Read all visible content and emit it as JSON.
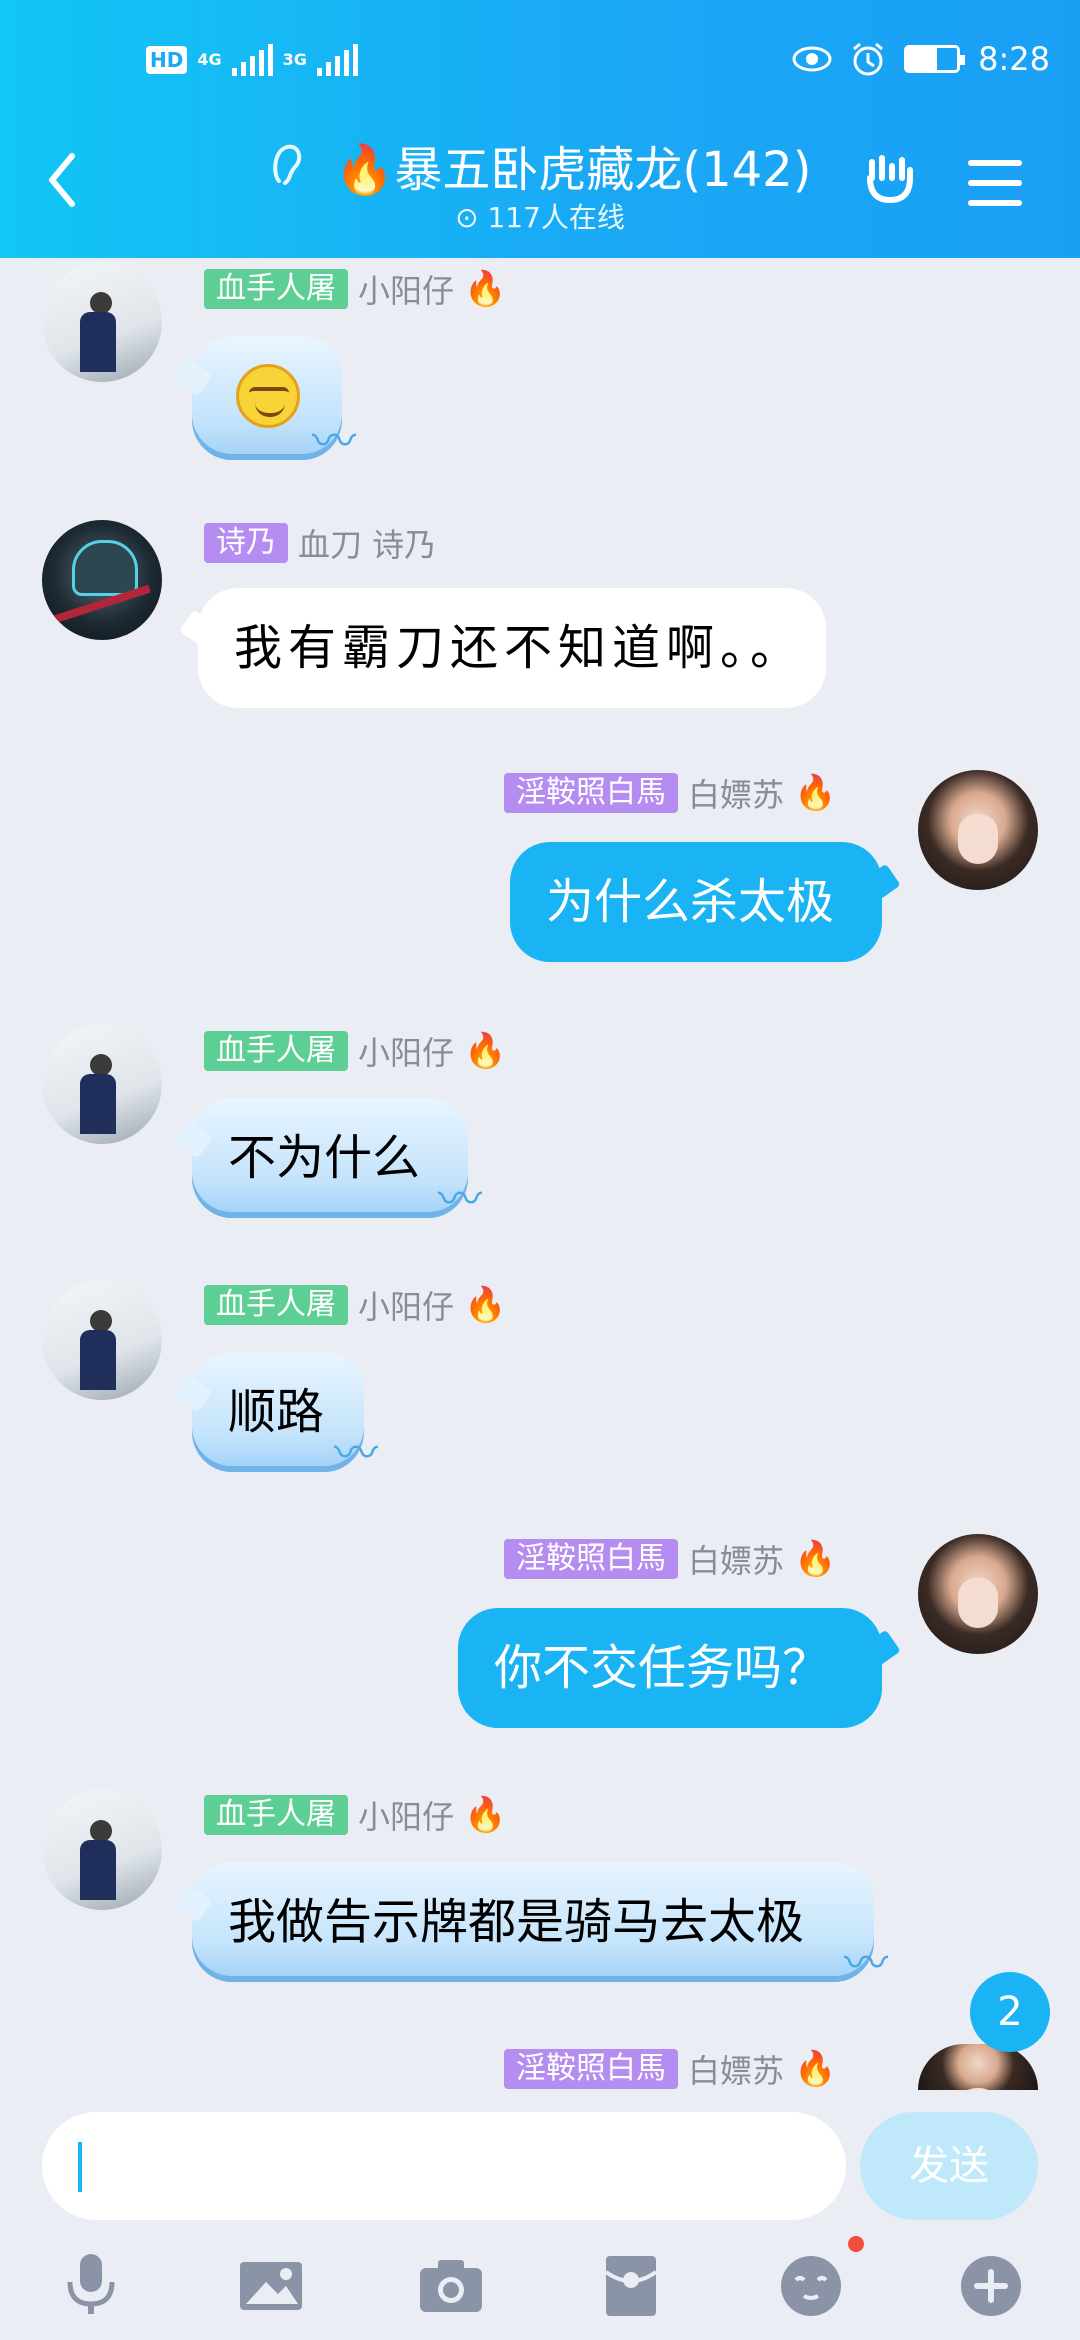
{
  "status_bar": {
    "hd": "HD",
    "net1": "4G",
    "net2": "3G",
    "time": "8:28",
    "battery_level": 0.6
  },
  "header": {
    "title": "🔥暴五卧虎藏龙(142)",
    "online": "117人在线"
  },
  "messages": [
    {
      "side": "left",
      "tag": "血手人屠",
      "name": "小阳仔",
      "text": "😏",
      "fire": "🔥"
    },
    {
      "side": "left",
      "tag": "诗乃",
      "name": "血刀   诗乃",
      "text": "我有霸刀还不知道啊。。"
    },
    {
      "side": "right",
      "tag": "淫鞍照白馬",
      "name": "白嫖苏",
      "text": "为什么杀太极",
      "fire": "🔥"
    },
    {
      "side": "left",
      "tag": "血手人屠",
      "name": "小阳仔",
      "text": "不为什么",
      "fire": "🔥"
    },
    {
      "side": "left",
      "tag": "血手人屠",
      "name": "小阳仔",
      "text": "顺路",
      "fire": "🔥"
    },
    {
      "side": "right",
      "tag": "淫鞍照白馬",
      "name": "白嫖苏",
      "text": "你不交任务吗？",
      "fire": "🔥"
    },
    {
      "side": "left",
      "tag": "血手人屠",
      "name": "小阳仔",
      "text": "我做告示牌都是骑马去太极",
      "fire": "🔥"
    },
    {
      "side": "right",
      "tag": "淫鞍照白馬",
      "name": "白嫖苏",
      "fire": "🔥"
    }
  ],
  "unread_count": "2",
  "input": {
    "value": "",
    "send_label": "发送"
  },
  "toolbar": [
    "microphone-icon",
    "image-icon",
    "camera-icon",
    "red-packet-icon",
    "emoji-icon",
    "plus-icon"
  ]
}
